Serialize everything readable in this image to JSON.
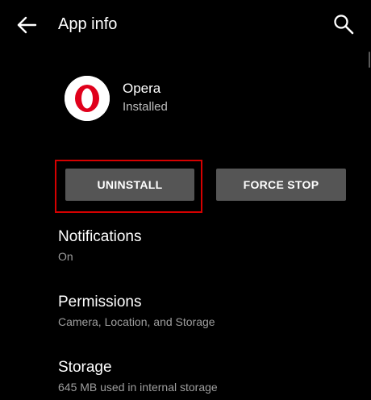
{
  "toolbar": {
    "title": "App info",
    "back_icon": "arrow-left-icon",
    "search_icon": "search-icon"
  },
  "app": {
    "name": "Opera",
    "status": "Installed",
    "icon": "opera-logo-icon",
    "brand_color": "#e0001b"
  },
  "actions": {
    "uninstall_label": "UNINSTALL",
    "force_stop_label": "FORCE STOP",
    "highlight_color": "#d50000",
    "button_color": "#555555"
  },
  "preferences": [
    {
      "title": "Notifications",
      "summary": "On"
    },
    {
      "title": "Permissions",
      "summary": "Camera, Location, and Storage"
    },
    {
      "title": "Storage",
      "summary": "645 MB used in internal storage"
    }
  ]
}
